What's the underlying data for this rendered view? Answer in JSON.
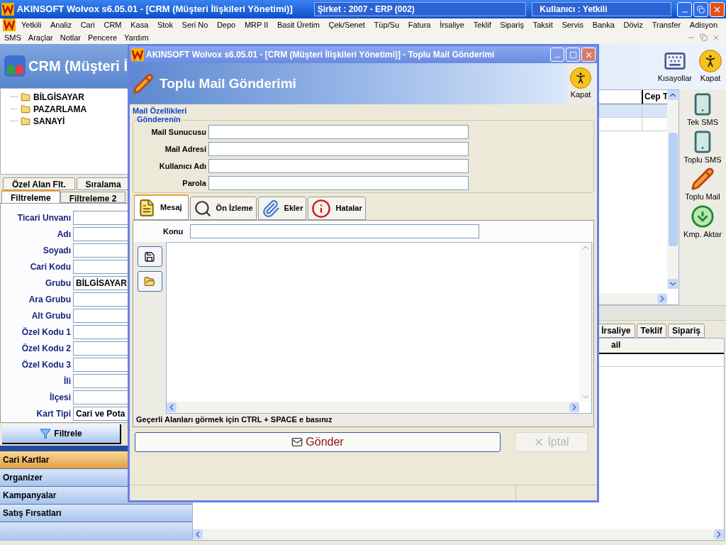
{
  "app": {
    "title": "AKINSOFT Wolvox s6.05.01 - [CRM (Müşteri İlişkileri Yönetimi)]",
    "company": "Şirket : 2007 - ERP (002)",
    "user": "Kullanıcı : Yetkili"
  },
  "menu": [
    [
      "Yetkili",
      "Analiz",
      "Cari",
      "CRM",
      "Kasa",
      "Stok",
      "Seri No",
      "Depo",
      "MRP II",
      "Basit Üretim",
      "Çek/Senet",
      "Tüp/Su",
      "Fatura",
      "İrsaliye",
      "Teklif",
      "Sipariş",
      "Taksit",
      "Servis",
      "Banka",
      "Döviz",
      "Transfer",
      "Adisyon"
    ],
    [
      "SMS",
      "Araçlar",
      "Notlar",
      "Pencere",
      "Yardım"
    ]
  ],
  "crm_header": "CRM (Müşteri İ",
  "tree": [
    {
      "label": "BİLGİSAYAR"
    },
    {
      "label": "PAZARLAMA"
    },
    {
      "label": "SANAYİ"
    }
  ],
  "filter_tabs_back": [
    {
      "label": "Özel Alan Flt.",
      "selected": false
    },
    {
      "label": "Sıralama",
      "selected": false
    }
  ],
  "filter_tabs_front": [
    {
      "label": "Filtreleme",
      "selected": true
    },
    {
      "label": "Filtreleme 2",
      "selected": false
    }
  ],
  "filter_fields": [
    {
      "label": "Ticari Unvanı"
    },
    {
      "label": "Adı"
    },
    {
      "label": "Soyadı"
    },
    {
      "label": "Cari Kodu"
    },
    {
      "label": "Grubu",
      "value": "BİLGİSAYAR"
    },
    {
      "label": "Ara Grubu"
    },
    {
      "label": "Alt Grubu"
    },
    {
      "label": "Özel Kodu 1"
    },
    {
      "label": "Özel Kodu 2"
    },
    {
      "label": "Özel Kodu 3"
    },
    {
      "label": "İli"
    },
    {
      "label": "İlçesi"
    },
    {
      "label": "Kart Tipi",
      "value": "Cari ve Pota"
    }
  ],
  "filter_button": "Filtrele",
  "nav": [
    {
      "label": "Cari Kartlar",
      "selected": true
    },
    {
      "label": "Organizer",
      "selected": false
    },
    {
      "label": "Kampanyalar",
      "selected": false
    },
    {
      "label": "Satış Fırsatları",
      "selected": false
    }
  ],
  "toolbar": [
    {
      "label": "Kısayollar",
      "kind": "keyboard"
    },
    {
      "label": "Kapat",
      "kind": "exit"
    }
  ],
  "grid": {
    "columns": [
      "Cep T"
    ],
    "rows": [
      {
        "selected": true
      },
      {
        "selected": false
      }
    ]
  },
  "side_tools": [
    {
      "label": "Tek SMS",
      "kind": "phone"
    },
    {
      "label": "Toplu SMS",
      "kind": "phone"
    },
    {
      "label": "Toplu Mail",
      "kind": "pencil"
    },
    {
      "label": "Kmp. Aktar",
      "kind": "transfer"
    }
  ],
  "bottom_tabs": [
    {
      "label": "İrsaliye",
      "selected": false
    },
    {
      "label": "Teklif",
      "selected": false
    },
    {
      "label": "Sipariş",
      "selected": false
    }
  ],
  "bottom_grid": {
    "columns": [
      "ail"
    ]
  },
  "dialog": {
    "title": "AKINSOFT Wolvox s6.05.01 - [CRM (Müşteri İlişkileri Yönetimi)] - Toplu Mail Gönderimi",
    "header": "Toplu Mail Gönderimi",
    "close": "Kapat",
    "group": "Mail Özellikleri",
    "subgroup": "Gönderenin",
    "fields": [
      {
        "label": "Mail Sunucusu"
      },
      {
        "label": "Mail Adresi"
      },
      {
        "label": "Kullanıcı Adı"
      },
      {
        "label": "Parola"
      }
    ],
    "tabs": [
      {
        "label": "Mesaj",
        "selected": true,
        "kind": "note"
      },
      {
        "label": "Ön İzleme",
        "selected": false,
        "kind": "preview"
      },
      {
        "label": "Ekler",
        "selected": false,
        "kind": "clip"
      },
      {
        "label": "Hatalar",
        "selected": false,
        "kind": "info"
      }
    ],
    "subject_label": "Konu",
    "hint": "Geçerli Alanları görmek için CTRL + SPACE e basınız",
    "send": {
      "label": "Gönder",
      "disabled": false
    },
    "cancel": {
      "label": "İptal",
      "disabled": true
    }
  }
}
